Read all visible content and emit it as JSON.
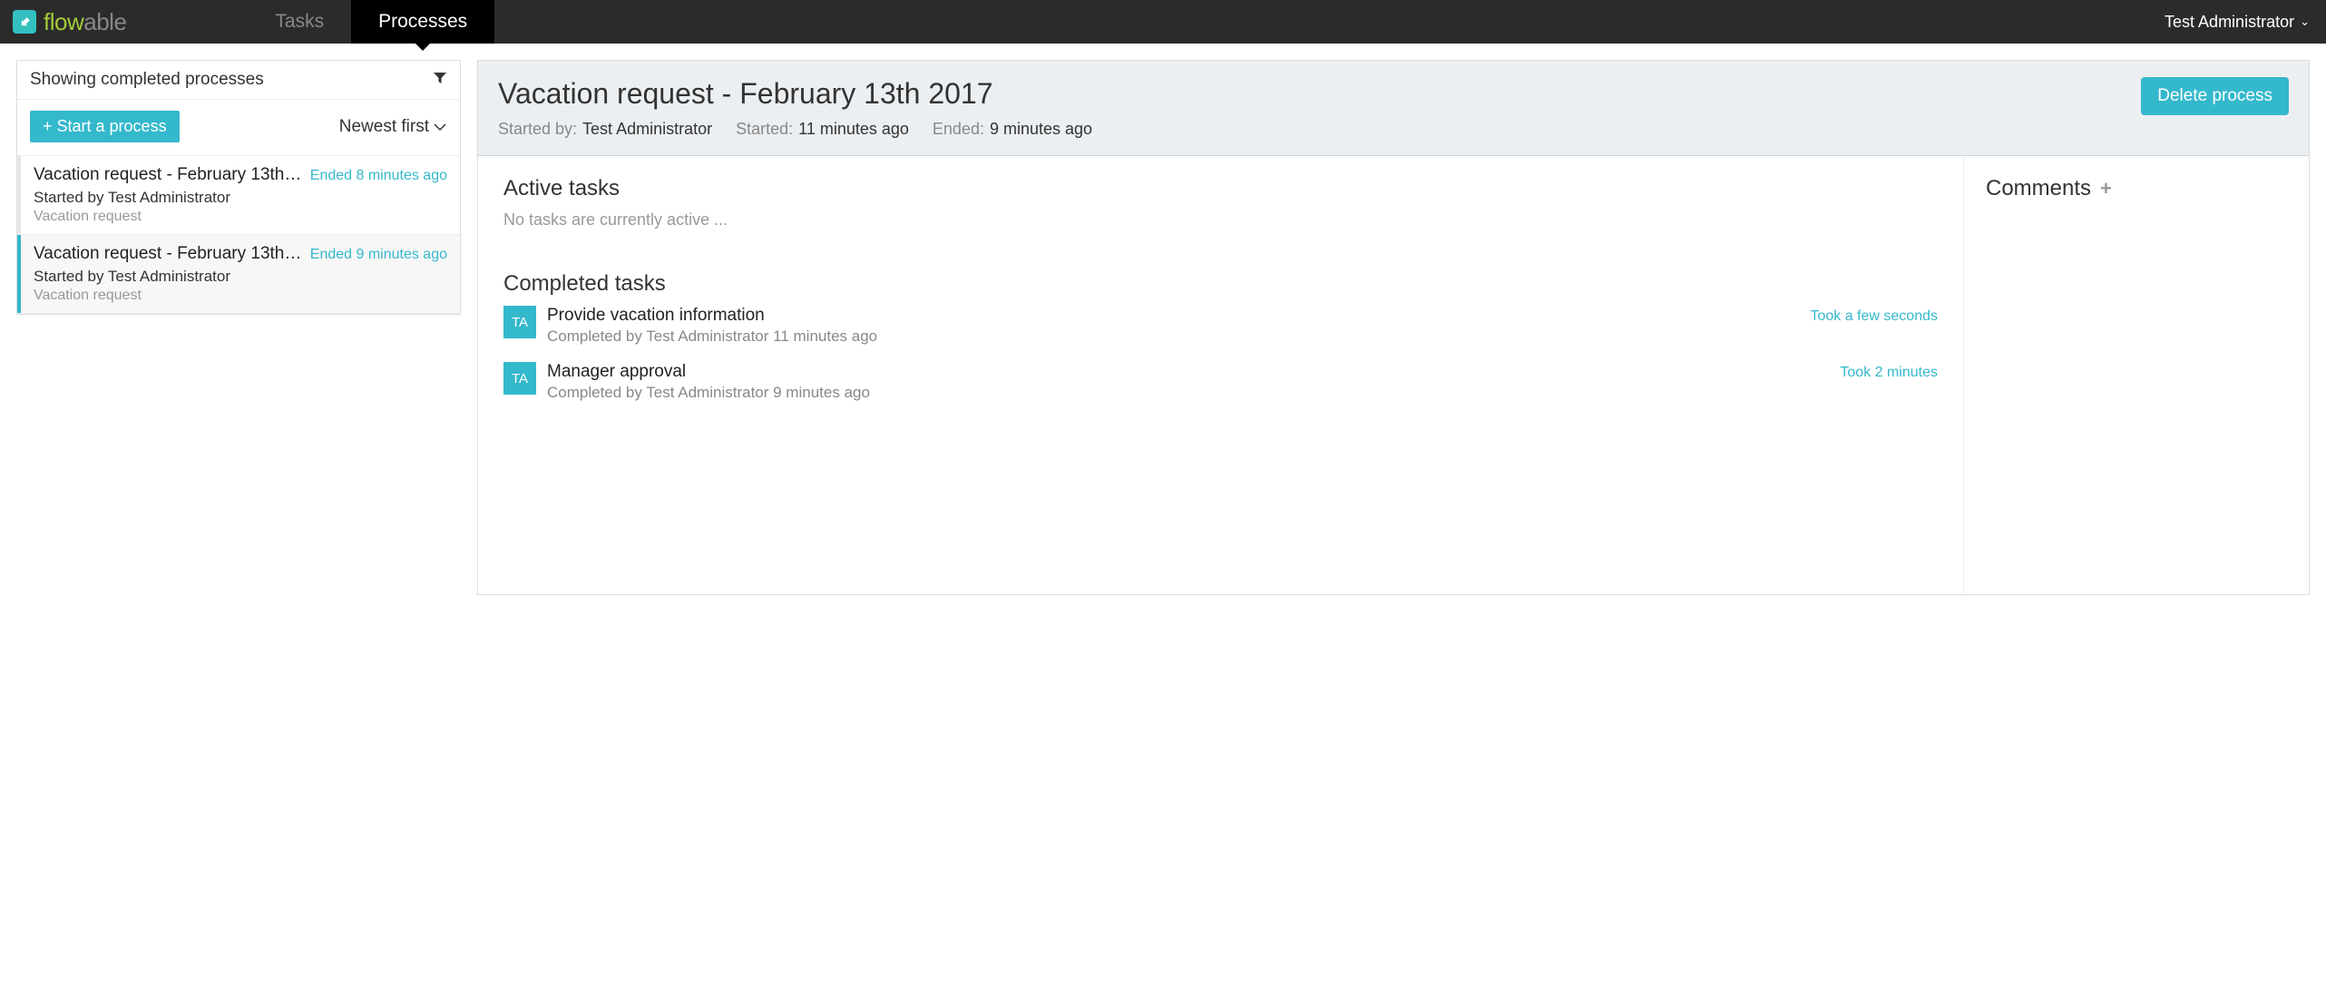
{
  "nav": {
    "logo_flow": "flow",
    "logo_able": "able",
    "tabs": {
      "tasks": "Tasks",
      "processes": "Processes"
    },
    "user": "Test Administrator"
  },
  "sidebar": {
    "heading": "Showing completed processes",
    "start_button": "+ Start a process",
    "sort_label": "Newest first",
    "items": [
      {
        "title": "Vacation request - February 13th…",
        "status": "Ended 8 minutes ago",
        "started_by": "Started by Test Administrator",
        "definition": "Vacation request"
      },
      {
        "title": "Vacation request - February 13th…",
        "status": "Ended 9 minutes ago",
        "started_by": "Started by Test Administrator",
        "definition": "Vacation request"
      }
    ]
  },
  "detail": {
    "title": "Vacation request - February 13th 2017",
    "delete_button": "Delete process",
    "meta": {
      "started_by_label": "Started by:",
      "started_by_value": "Test Administrator",
      "started_label": "Started:",
      "started_value": "11 minutes ago",
      "ended_label": "Ended:",
      "ended_value": "9 minutes ago"
    },
    "active_tasks_title": "Active tasks",
    "active_tasks_empty": "No tasks are currently active ...",
    "completed_tasks_title": "Completed tasks",
    "completed_tasks": [
      {
        "initials": "TA",
        "title": "Provide vacation information",
        "duration": "Took a few seconds",
        "sub": "Completed by Test Administrator 11 minutes ago"
      },
      {
        "initials": "TA",
        "title": "Manager approval",
        "duration": "Took 2 minutes",
        "sub": "Completed by Test Administrator 9 minutes ago"
      }
    ],
    "comments_title": "Comments"
  }
}
